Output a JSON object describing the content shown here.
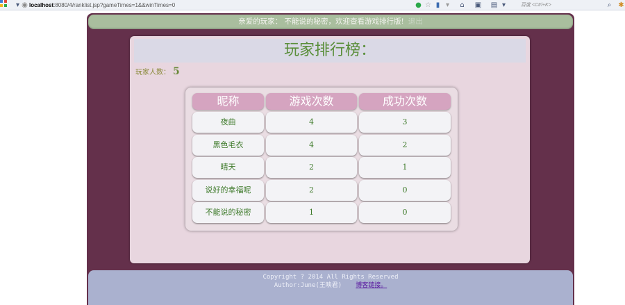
{
  "browser": {
    "url_host": "localhost",
    "url_rest": ":8080/4/ranklist.jsp?gameTimes=1&&winTimes=0",
    "search_placeholder": "百度 <Ctrl+K>"
  },
  "header": {
    "welcome": "亲爱的玩家： 不能说的秘密，欢迎查看游戏排行版!",
    "link": "退出"
  },
  "page": {
    "title": "玩家排行榜：",
    "player_count_label": "玩家人数：",
    "player_count": "5"
  },
  "table": {
    "columns": [
      "昵称",
      "游戏次数",
      "成功次数"
    ],
    "rows": [
      [
        "夜曲",
        "4",
        "3"
      ],
      [
        "黑色毛衣",
        "4",
        "2"
      ],
      [
        "晴天",
        "2",
        "1"
      ],
      [
        "说好的幸福呢",
        "2",
        "0"
      ],
      [
        "不能说的秘密",
        "1",
        "0"
      ]
    ]
  },
  "footer": {
    "copyright": "Copyright ? 2014 All Rights Reserved",
    "author": "Author:June(王映君)",
    "blog_link": "博客链接。"
  }
}
